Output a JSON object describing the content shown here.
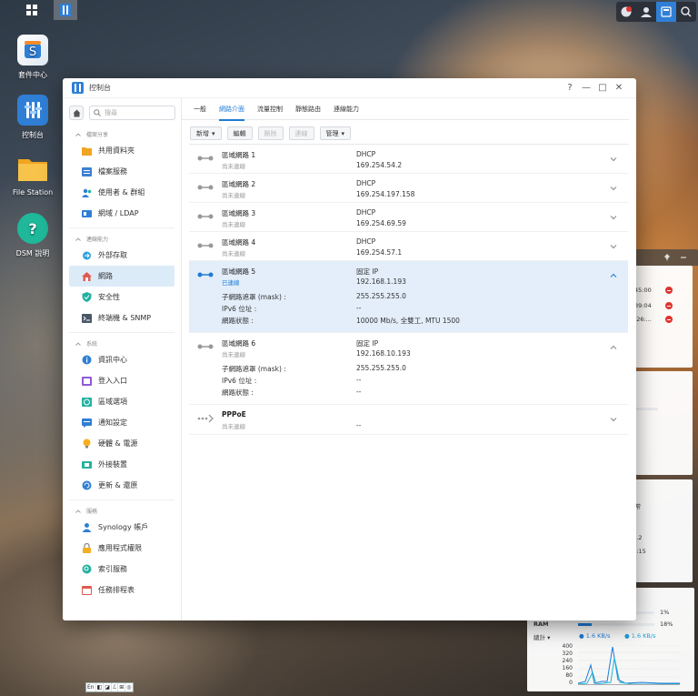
{
  "desktop": {
    "icons": [
      {
        "label": "套件中心"
      },
      {
        "label": "控制台"
      },
      {
        "label": "File Station"
      },
      {
        "label": "DSM 說明"
      }
    ]
  },
  "window": {
    "title": "控制台",
    "controls": {
      "help": "?",
      "minimize": "—",
      "maximize": "□",
      "close": "✕"
    }
  },
  "sidebar": {
    "search_placeholder": "搜尋",
    "sections": [
      {
        "header": "檔案分享",
        "items": [
          "共用資料夾",
          "檔案服務",
          "使用者 & 群組",
          "網域 / LDAP"
        ]
      },
      {
        "header": "連線能力",
        "items": [
          "外部存取",
          "網路",
          "安全性",
          "終端機 & SNMP"
        ]
      },
      {
        "header": "系統",
        "items": [
          "資訊中心",
          "登入入口",
          "區域選項",
          "通知設定",
          "硬體 & 電源",
          "外接裝置",
          "更新 & 還原"
        ]
      },
      {
        "header": "服務",
        "items": [
          "Synology 帳戶",
          "應用程式權限",
          "索引服務",
          "任務排程表"
        ]
      }
    ],
    "active_item": "網路"
  },
  "tabs": [
    "一般",
    "網路介面",
    "流量控制",
    "靜態路由",
    "連線能力"
  ],
  "active_tab": "網路介面",
  "toolbar": {
    "create": "新增",
    "edit": "編輯",
    "delete": "刪除",
    "connect": "連線",
    "manage": "管理"
  },
  "interfaces": [
    {
      "name": "區域網路 1",
      "status": "尚未連線",
      "kind": "DHCP",
      "ip": "169.254.54.2"
    },
    {
      "name": "區域網路 2",
      "status": "尚未連線",
      "kind": "DHCP",
      "ip": "169.254.197.158"
    },
    {
      "name": "區域網路 3",
      "status": "尚未連線",
      "kind": "DHCP",
      "ip": "169.254.69.59"
    },
    {
      "name": "區域網路 4",
      "status": "尚未連線",
      "kind": "DHCP",
      "ip": "169.254.57.1"
    },
    {
      "name": "區域網路 5",
      "status": "已連線",
      "kind": "固定 IP",
      "ip": "192.168.1.193",
      "details": [
        {
          "label": "子網路遮罩 (mask) :",
          "value": "255.255.255.0"
        },
        {
          "label": "IPv6 位址 :",
          "value": "--"
        },
        {
          "label": "網路狀態 :",
          "value": "10000 Mb/s, 全雙工, MTU 1500"
        }
      ]
    },
    {
      "name": "區域網路 6",
      "status": "尚未連線",
      "kind": "固定 IP",
      "ip": "192.168.10.193",
      "details": [
        {
          "label": "子網路遮罩 (mask) :",
          "value": "255.255.255.0"
        },
        {
          "label": "IPv6 位址 :",
          "value": "--"
        },
        {
          "label": "網路狀態 :",
          "value": "--"
        }
      ]
    },
    {
      "name": "PPPoE",
      "status": "尚未連線",
      "kind": "",
      "ip": "--"
    }
  ],
  "widget": {
    "log_times": [
      "45:00",
      "39:04",
      ":26:..."
    ],
    "info_lines": [
      "正常",
      "00",
      "54.2",
      "29:15"
    ],
    "cpu_percent": "1%",
    "ram_label": "RAM",
    "ram_percent": "18%",
    "total_label": "總計",
    "upload": "1.6 KB/s",
    "download": "1.6 KB/s",
    "chart_ticks": [
      "400",
      "320",
      "240",
      "160",
      "80",
      "0"
    ]
  },
  "ime": [
    "En",
    "◧",
    "◪",
    "ℒ",
    "⊞",
    "◎"
  ],
  "colors": {
    "accent": "#1f7bd6",
    "active_row": "#e3eefa",
    "sidebar_active": "#dcebf8",
    "danger": "#e0332f"
  }
}
